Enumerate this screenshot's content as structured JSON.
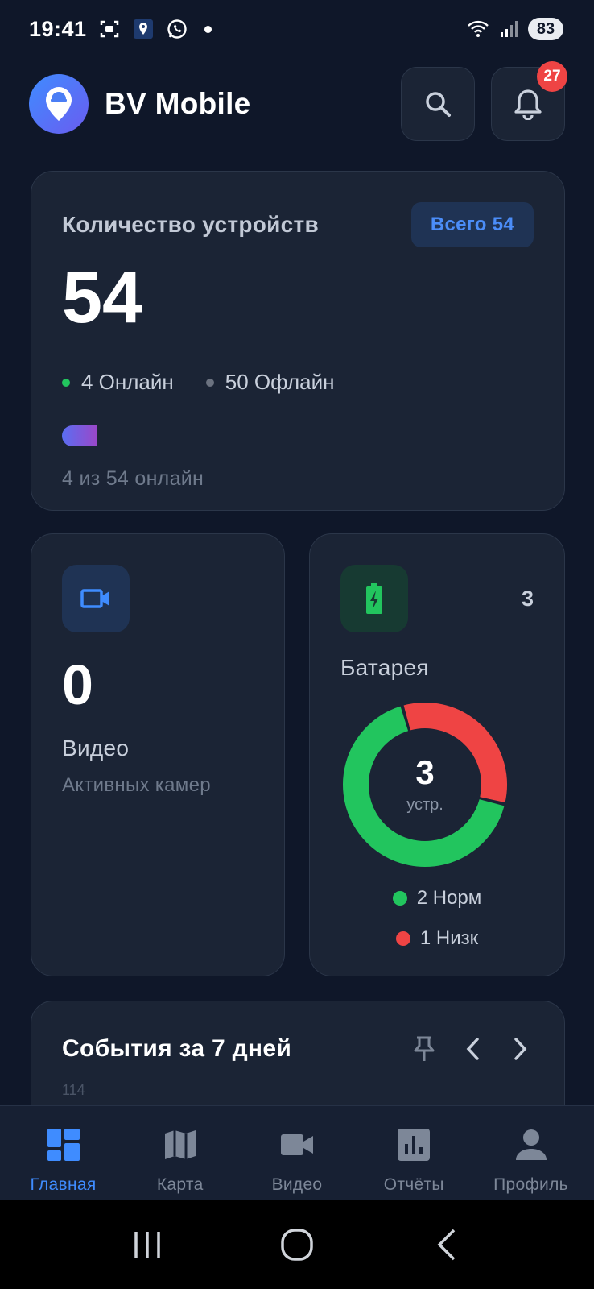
{
  "status_bar": {
    "time": "19:41",
    "battery": "83"
  },
  "header": {
    "app_title": "BV Mobile",
    "notification_count": "27"
  },
  "devices": {
    "title": "Количество устройств",
    "total_chip": "Всего 54",
    "count": "54",
    "online_label": "4 Онлайн",
    "offline_label": "50 Офлайн",
    "online_fraction": 0.074,
    "caption": "4 из 54 онлайн"
  },
  "video": {
    "count": "0",
    "title": "Видео",
    "subtitle": "Активных камер"
  },
  "battery": {
    "count": "3",
    "title": "Батарея",
    "center_value": "3",
    "center_unit": "устр.",
    "legend": [
      {
        "label": "2 Норм",
        "value": 2,
        "color": "#22c55e"
      },
      {
        "label": "1 Низк",
        "value": 1,
        "color": "#ef4444"
      }
    ]
  },
  "events": {
    "title": "События за 7 дней",
    "axis_top": "114"
  },
  "nav": {
    "items": [
      {
        "label": "Главная",
        "active": true
      },
      {
        "label": "Карта",
        "active": false
      },
      {
        "label": "Видео",
        "active": false
      },
      {
        "label": "Отчёты",
        "active": false
      },
      {
        "label": "Профиль",
        "active": false
      }
    ]
  },
  "colors": {
    "accent": "#3f8cff",
    "online": "#22c55e",
    "low": "#ef4444",
    "offline": "#6b7280"
  }
}
